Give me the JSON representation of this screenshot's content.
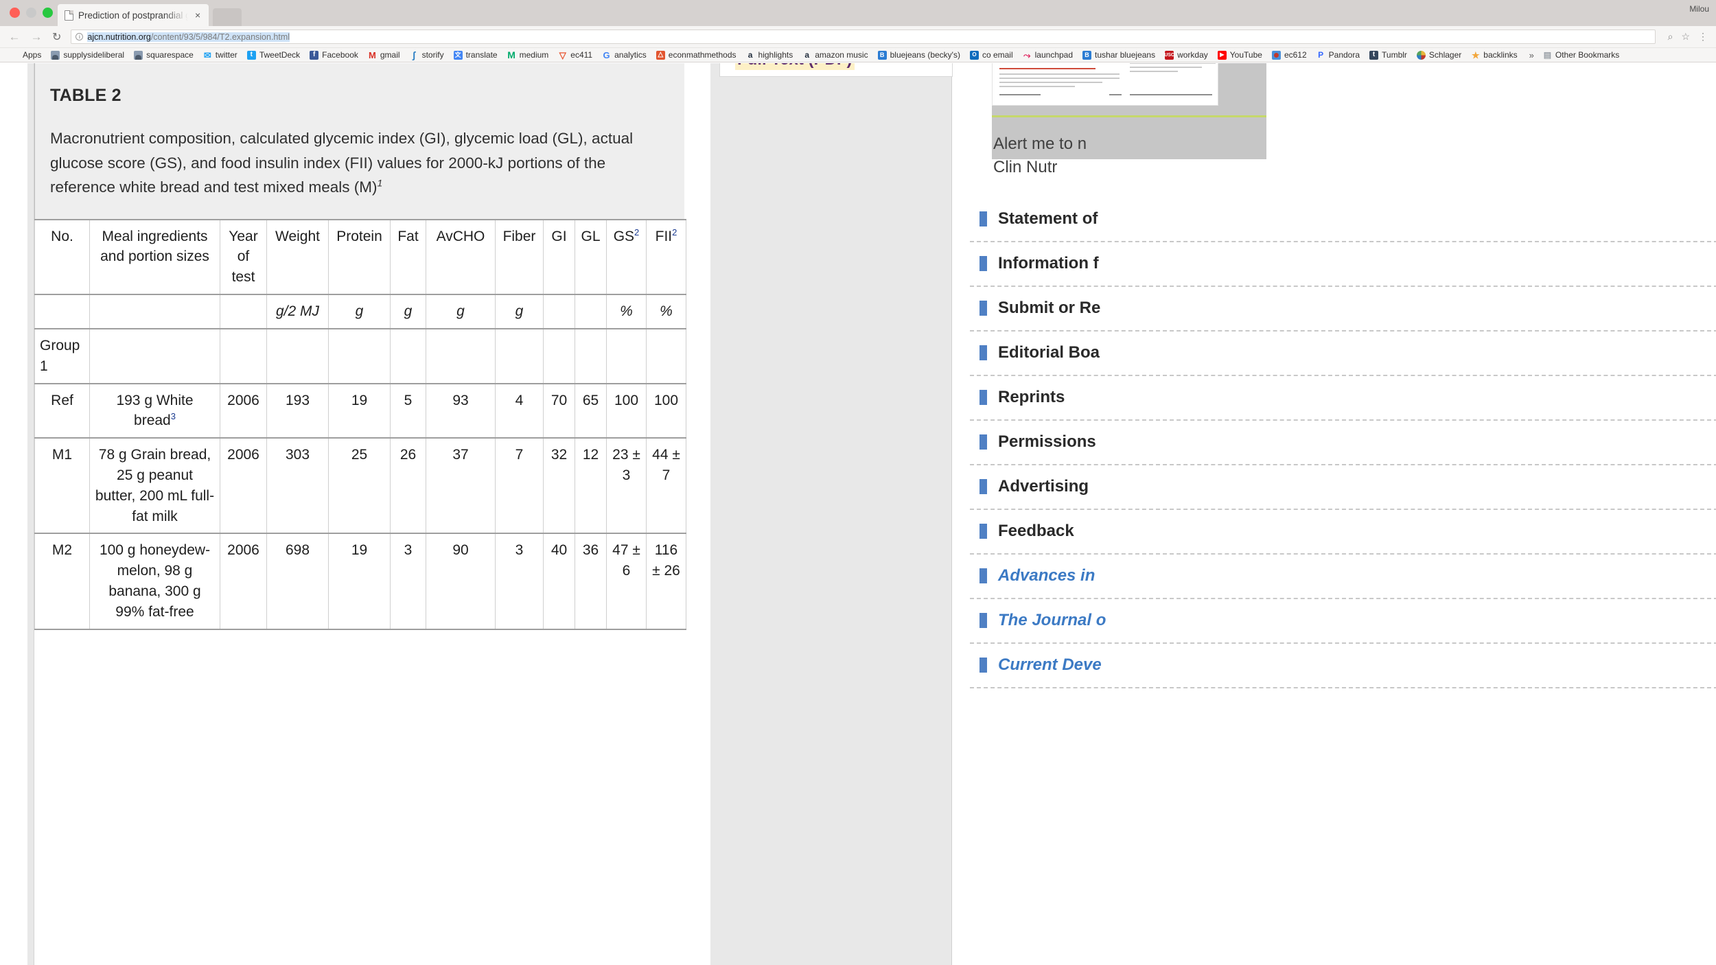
{
  "browser": {
    "tab": {
      "title": "Prediction of postprandial glyc",
      "close_label": "×",
      "favicon": "page-icon"
    },
    "menubar_right": "Milou",
    "nav": {
      "back": "←",
      "forward": "→",
      "reload": "↻"
    },
    "omnibox": {
      "info_icon": "ⓘ",
      "host": "ajcn.nutrition.org",
      "path": "/content/93/5/984/T2.expansion.html",
      "star": "☆",
      "zoom": "⌕",
      "menu": "⋮"
    },
    "bookmarks": [
      {
        "label": "Apps",
        "icon": "apps-grid-icon"
      },
      {
        "label": "supplysideliberal",
        "icon": "avatar-icon"
      },
      {
        "label": "squarespace",
        "icon": "avatar-icon"
      },
      {
        "label": "twitter",
        "icon": "twitter-icon",
        "glyph": "✉"
      },
      {
        "label": "TweetDeck",
        "icon": "tweetdeck-icon",
        "glyph": "t"
      },
      {
        "label": "Facebook",
        "icon": "facebook-icon",
        "glyph": "f"
      },
      {
        "label": "gmail",
        "icon": "gmail-icon",
        "glyph": "M"
      },
      {
        "label": "storify",
        "icon": "storify-icon",
        "glyph": "ʃ"
      },
      {
        "label": "translate",
        "icon": "translate-icon",
        "glyph": "文"
      },
      {
        "label": "medium",
        "icon": "medium-icon",
        "glyph": "M"
      },
      {
        "label": "ec411",
        "icon": "ec411-icon",
        "glyph": "▽"
      },
      {
        "label": "analytics",
        "icon": "google-analytics-icon",
        "glyph": "G"
      },
      {
        "label": "econmathmethods",
        "icon": "econmathmethods-icon",
        "glyph": "△"
      },
      {
        "label": "highlights",
        "icon": "amazon-icon",
        "glyph": "a"
      },
      {
        "label": "amazon music",
        "icon": "amazon-icon",
        "glyph": "a"
      },
      {
        "label": "bluejeans (becky's)",
        "icon": "bluejeans-icon",
        "glyph": "B"
      },
      {
        "label": "co email",
        "icon": "outlook-icon",
        "glyph": "O"
      },
      {
        "label": "launchpad",
        "icon": "launchpad-icon",
        "glyph": "⤳"
      },
      {
        "label": "tushar bluejeans",
        "icon": "bluejeans-icon",
        "glyph": "B"
      },
      {
        "label": "workday",
        "icon": "workday-icon",
        "glyph": "USC"
      },
      {
        "label": "YouTube",
        "icon": "youtube-icon",
        "glyph": "▶"
      },
      {
        "label": "ec612",
        "icon": "ec612-icon",
        "glyph": ""
      },
      {
        "label": "Pandora",
        "icon": "pandora-icon",
        "glyph": "P"
      },
      {
        "label": "Tumblr",
        "icon": "tumblr-icon",
        "glyph": "t"
      },
      {
        "label": "Schlager",
        "icon": "schlager-icon",
        "glyph": ""
      },
      {
        "label": "backlinks",
        "icon": "star-icon",
        "glyph": "★"
      }
    ],
    "bookmarks_overflow": "»",
    "other_bookmarks": {
      "label": "Other Bookmarks",
      "icon": "folder-icon",
      "glyph": "▤"
    }
  },
  "page": {
    "pdf_callout": {
      "label": "Full Text (PDF)",
      "arrow": "➜"
    },
    "alert_panel": {
      "text": "Alert me to n\nClin Nutr"
    },
    "sidebar": [
      {
        "label": "Statement of",
        "italic": false
      },
      {
        "label": "Information f",
        "italic": false
      },
      {
        "label": "Submit or Re",
        "italic": false
      },
      {
        "label": "Editorial Boa",
        "italic": false
      },
      {
        "label": "Reprints",
        "italic": false
      },
      {
        "label": "Permissions",
        "italic": false
      },
      {
        "label": "Advertising",
        "italic": false
      },
      {
        "label": "Feedback",
        "italic": false
      },
      {
        "label": "Advances in",
        "italic": true
      },
      {
        "label": "The Journal o",
        "italic": true
      },
      {
        "label": "Current Deve",
        "italic": true
      }
    ]
  },
  "table": {
    "number": "TABLE 2",
    "caption": "Macronutrient composition, calculated glycemic index (GI), glycemic load (GL), actual glucose score (GS), and food insulin index (FII) values for 2000-kJ portions of the reference white bread and test mixed meals (M)",
    "caption_footnote": "1",
    "headers": [
      {
        "label": "No.",
        "sup": ""
      },
      {
        "label": "Meal ingredients and portion sizes",
        "sup": ""
      },
      {
        "label": "Year of test",
        "sup": ""
      },
      {
        "label": "Weight",
        "sup": ""
      },
      {
        "label": "Protein",
        "sup": ""
      },
      {
        "label": "Fat",
        "sup": ""
      },
      {
        "label": "AvCHO",
        "sup": ""
      },
      {
        "label": "Fiber",
        "sup": ""
      },
      {
        "label": "GI",
        "sup": ""
      },
      {
        "label": "GL",
        "sup": ""
      },
      {
        "label": "GS",
        "sup": "2"
      },
      {
        "label": "FII",
        "sup": "2"
      }
    ],
    "units": [
      "",
      "",
      "",
      "g/2 MJ",
      "g",
      "g",
      "g",
      "g",
      "",
      "",
      "%",
      "%"
    ],
    "rows": [
      {
        "type": "group",
        "cells": [
          "Group 1",
          "",
          "",
          "",
          "",
          "",
          "",
          "",
          "",
          "",
          "",
          ""
        ]
      },
      {
        "type": "data",
        "cells": [
          "Ref",
          "193 g White bread",
          "2006",
          "193",
          "19",
          "5",
          "93",
          "4",
          "70",
          "65",
          "100",
          "100"
        ],
        "meal_sup": "3"
      },
      {
        "type": "data",
        "cells": [
          "M1",
          "78 g Grain bread, 25 g peanut butter, 200 mL full-fat milk",
          "2006",
          "303",
          "25",
          "26",
          "37",
          "7",
          "32",
          "12",
          "23 ± 3",
          "44 ± 7"
        ],
        "meal_sup": ""
      },
      {
        "type": "data",
        "cells": [
          "M2",
          "100 g honeydew-melon, 98 g banana, 300 g 99% fat-free",
          "2006",
          "698",
          "19",
          "3",
          "90",
          "3",
          "40",
          "36",
          "47 ± 6",
          "116 ± 26"
        ],
        "meal_sup": ""
      }
    ]
  }
}
